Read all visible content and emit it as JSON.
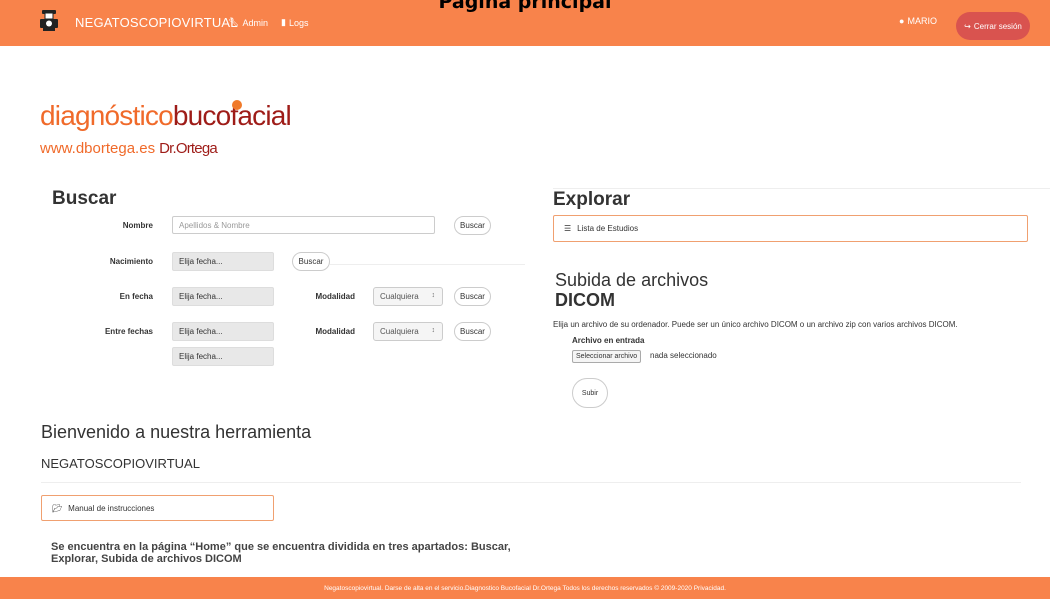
{
  "caption": "Página principal",
  "navbar": {
    "brand": "NEGATOSCOPIOVIRTUAL",
    "admin": "Admin",
    "logs": "Logs",
    "user": "MARIO",
    "logout": "Cerrar sesión"
  },
  "logo": {
    "part1": "diagnóstico",
    "part2": "bucofacial",
    "url": "www.dbortega.es",
    "doctor": "Dr.Ortega"
  },
  "buscar": {
    "title": "Buscar",
    "nombre_label": "Nombre",
    "nombre_placeholder": "Apellidos & Nombre",
    "nacimiento_label": "Nacimiento",
    "en_fecha_label": "En fecha",
    "entre_fechas_label": "Entre fechas",
    "date_placeholder": "Elija fecha...",
    "modalidad_label": "Modalidad",
    "modalidad_value": "Cualquiera",
    "buscar_button": "Buscar"
  },
  "explorar": {
    "title": "Explorar",
    "lista": "Lista de Estudios"
  },
  "upload": {
    "title_line1": "Subida de archivos",
    "title_line2": "DICOM",
    "desc": "Elija un archivo de su ordenador. Puede ser un único archivo DICOM o un archivo zip con varios archivos DICOM.",
    "file_label": "Archivo en entrada",
    "file_button": "Seleccionar archivo",
    "file_none": "nada seleccionado",
    "subir": "Subir"
  },
  "welcome": {
    "title": "Bienvenido a nuestra herramienta",
    "app": "NEGATOSCOPIOVIRTUAL",
    "manual": "Manual de instrucciones",
    "info": "Se encuentra en la página “Home” que se encuentra dividida en tres apartados: Buscar, Explorar, Subida de archivos DICOM"
  },
  "footer": "Negatoscopiovirtual. Darse de alta en el servicio.Diagnostico Bucofacial Dr.Ortega Todos los derechos reservados © 2009-2020 Privacidad.",
  "colors": {
    "nav": "#f8834b",
    "logout": "#d9534f",
    "logo_orange": "#f06a2a",
    "logo_red": "#9e1c18"
  }
}
